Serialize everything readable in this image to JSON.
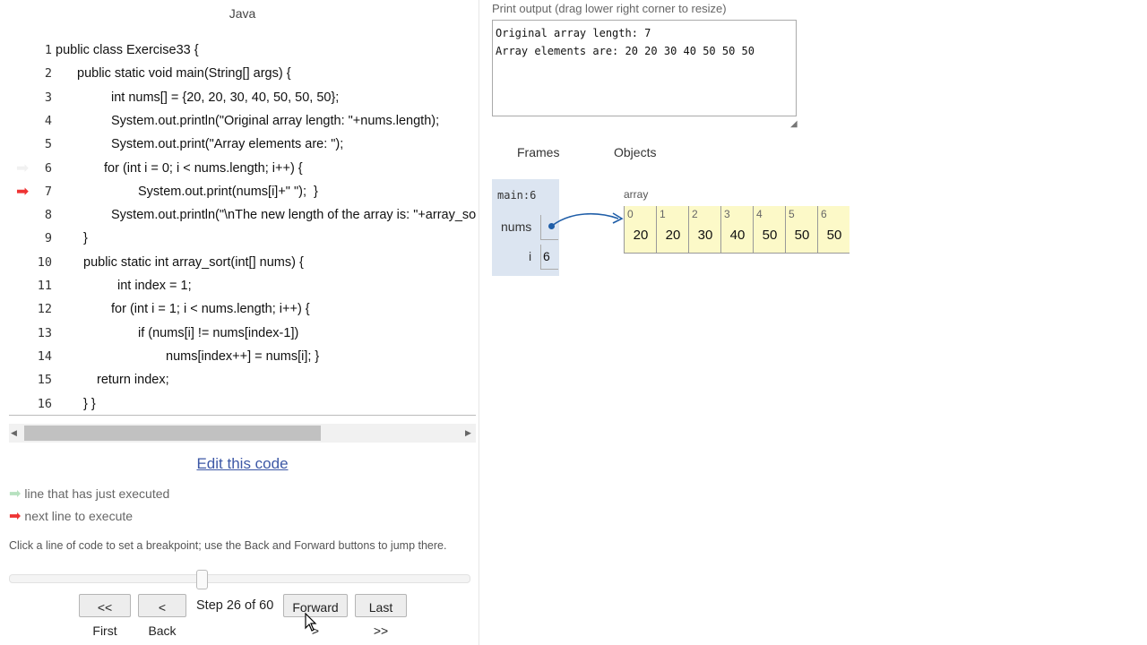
{
  "code_panel": {
    "language": "Java",
    "lines": [
      {
        "num": "1",
        "text": "public class Exercise33 {",
        "indent": 62,
        "marker": ""
      },
      {
        "num": "2",
        "text": "public static void main(String[] args) {",
        "indent": 86,
        "marker": ""
      },
      {
        "num": "3",
        "text": "int nums[] = {20, 20, 30, 40, 50, 50, 50};",
        "indent": 124,
        "marker": ""
      },
      {
        "num": "4",
        "text": "System.out.println(\"Original array length: \"+nums.length);",
        "indent": 124,
        "marker": ""
      },
      {
        "num": "5",
        "text": "System.out.print(\"Array elements are: \");",
        "indent": 124,
        "marker": ""
      },
      {
        "num": "6",
        "text": "for (int i = 0; i < nums.length; i++) {",
        "indent": 116,
        "marker": "prev"
      },
      {
        "num": "7",
        "text": "System.out.print(nums[i]+\" \");  }",
        "indent": 154,
        "marker": "next"
      },
      {
        "num": "8",
        "text": "System.out.println(\"\\nThe new length of the array is: \"+array_sort(nums));",
        "indent": 124,
        "marker": ""
      },
      {
        "num": "9",
        "text": "}",
        "indent": 93,
        "marker": ""
      },
      {
        "num": "10",
        "text": "public static int array_sort(int[] nums) {",
        "indent": 93,
        "marker": ""
      },
      {
        "num": "11",
        "text": "int index = 1;",
        "indent": 131,
        "marker": ""
      },
      {
        "num": "12",
        "text": "for (int i = 1; i < nums.length; i++) {",
        "indent": 124,
        "marker": ""
      },
      {
        "num": "13",
        "text": "if (nums[i] != nums[index-1])",
        "indent": 154,
        "marker": ""
      },
      {
        "num": "14",
        "text": "nums[index++] = nums[i]; }",
        "indent": 185,
        "marker": ""
      },
      {
        "num": "15",
        "text": "return index;",
        "indent": 108,
        "marker": ""
      },
      {
        "num": "16",
        "text": "} }",
        "indent": 93,
        "marker": ""
      }
    ],
    "edit_link": "Edit this code",
    "legend_prev": "line that has just executed",
    "legend_next": "next line to execute",
    "hint": "Click a line of code to set a breakpoint; use the Back and Forward buttons to jump there.",
    "step_text": "Step 26 of 60",
    "step_progress": 0.42,
    "buttons": {
      "first": "<< First",
      "back": "< Back",
      "forward": "Forward >",
      "last": "Last >>"
    }
  },
  "output_panel": {
    "label": "Print output (drag lower right corner to resize)",
    "lines": [
      "Original array length: 7",
      "Array elements are: 20 20 30 40 50 50 50"
    ]
  },
  "visualizer": {
    "frames_header": "Frames",
    "objects_header": "Objects",
    "frame_name": "main:6",
    "vars": {
      "nums_name": "nums",
      "i_name": "i",
      "i_value": "6"
    },
    "array_label": "array",
    "array": [
      {
        "index": "0",
        "value": "20"
      },
      {
        "index": "1",
        "value": "20"
      },
      {
        "index": "2",
        "value": "30"
      },
      {
        "index": "3",
        "value": "40"
      },
      {
        "index": "4",
        "value": "50"
      },
      {
        "index": "5",
        "value": "50"
      },
      {
        "index": "6",
        "value": "50"
      }
    ]
  },
  "colors": {
    "next_arrow": "#ee3333",
    "prev_arrow": "#b7e1bf",
    "frame_bg": "#dce5f1",
    "array_bg": "#fcf9c8",
    "pointer": "#1f5ea8",
    "link": "#3d58a6"
  }
}
